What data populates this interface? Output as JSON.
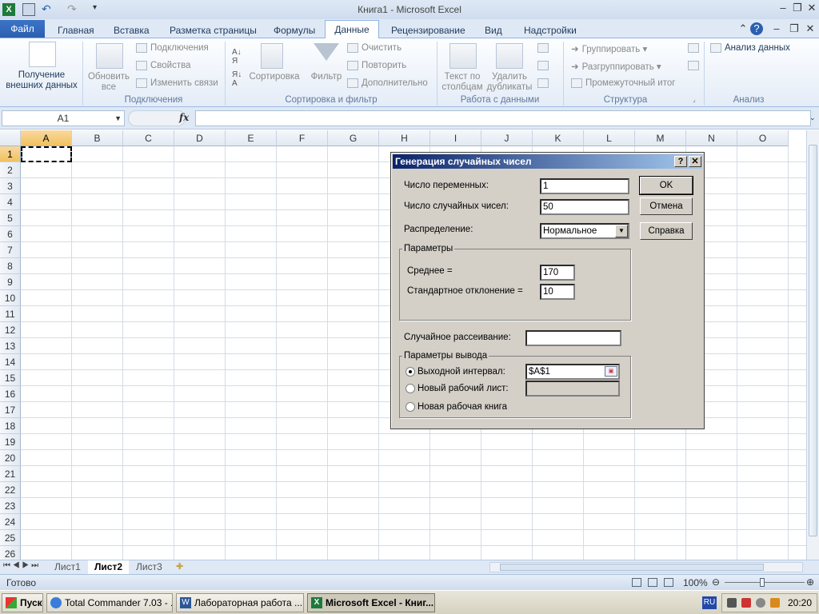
{
  "window": {
    "title": "Книга1 - Microsoft Excel"
  },
  "ribbon_tabs": [
    {
      "label": "Файл"
    },
    {
      "label": "Главная"
    },
    {
      "label": "Вставка"
    },
    {
      "label": "Разметка страницы"
    },
    {
      "label": "Формулы"
    },
    {
      "label": "Данные"
    },
    {
      "label": "Рецензирование"
    },
    {
      "label": "Вид"
    },
    {
      "label": "Надстройки"
    }
  ],
  "ribbon": {
    "get_external_1": "Получение",
    "get_external_2": "внешних данных",
    "refresh_1": "Обновить",
    "refresh_2": "все",
    "connections": "Подключения",
    "properties": "Свойства",
    "edit_links": "Изменить связи",
    "group_connections": "Подключения",
    "sort": "Сортировка",
    "filter": "Фильтр",
    "clear": "Очистить",
    "reapply": "Повторить",
    "advanced": "Дополнительно",
    "group_sort": "Сортировка и фильтр",
    "text_to_cols_1": "Текст по",
    "text_to_cols_2": "столбцам",
    "remove_dup_1": "Удалить",
    "remove_dup_2": "дубликаты",
    "group_data_tools": "Работа с данными",
    "group_btn": "Группировать",
    "ungroup_btn": "Разгруппировать",
    "subtotal": "Промежуточный итог",
    "group_outline": "Структура",
    "data_analysis": "Анализ данных",
    "group_analysis": "Анализ"
  },
  "formula_bar": {
    "name_box": "A1",
    "fx": "fx",
    "formula": ""
  },
  "columns": [
    "A",
    "B",
    "C",
    "D",
    "E",
    "F",
    "G",
    "H",
    "I",
    "J",
    "K",
    "L",
    "M",
    "N",
    "O"
  ],
  "rows": [
    "1",
    "2",
    "3",
    "4",
    "5",
    "6",
    "7",
    "8",
    "9",
    "10",
    "11",
    "12",
    "13",
    "14",
    "15",
    "16",
    "17",
    "18",
    "19",
    "20",
    "21",
    "22",
    "23",
    "24",
    "25",
    "26"
  ],
  "sheets": [
    {
      "label": "Лист1"
    },
    {
      "label": "Лист2"
    },
    {
      "label": "Лист3"
    }
  ],
  "status": {
    "ready": "Готово",
    "zoom": "100%"
  },
  "dialog": {
    "title": "Генерация случайных чисел",
    "num_vars_label": "Число переменных:",
    "num_vars_value": "1",
    "num_random_label": "Число случайных чисел:",
    "num_random_value": "50",
    "distribution_label": "Распределение:",
    "distribution_value": "Нормальное",
    "params_legend": "Параметры",
    "mean_label": "Среднее =",
    "mean_value": "170",
    "stdev_label": "Стандартное отклонение =",
    "stdev_value": "10",
    "seed_label": "Случайное рассеивание:",
    "seed_value": "",
    "output_legend": "Параметры вывода",
    "output_range_label": "Выходной интервал:",
    "output_range_value": "$A$1",
    "new_sheet_label": "Новый рабочий лист:",
    "new_book_label": "Новая рабочая книга",
    "ok": "OK",
    "cancel": "Отмена",
    "help": "Справка"
  },
  "taskbar": {
    "start": "Пуск",
    "items": [
      {
        "label": "Total Commander 7.03 - ..."
      },
      {
        "label": "Лабораторная работа ..."
      },
      {
        "label": "Microsoft Excel - Книг..."
      }
    ],
    "lang": "RU",
    "clock": "20:20"
  },
  "colors": {
    "accent": "#2c5fb1",
    "selected_header": "#f1c15f",
    "dialog_bg": "#d4d0c8",
    "title_gradient_start": "#0a246a"
  }
}
